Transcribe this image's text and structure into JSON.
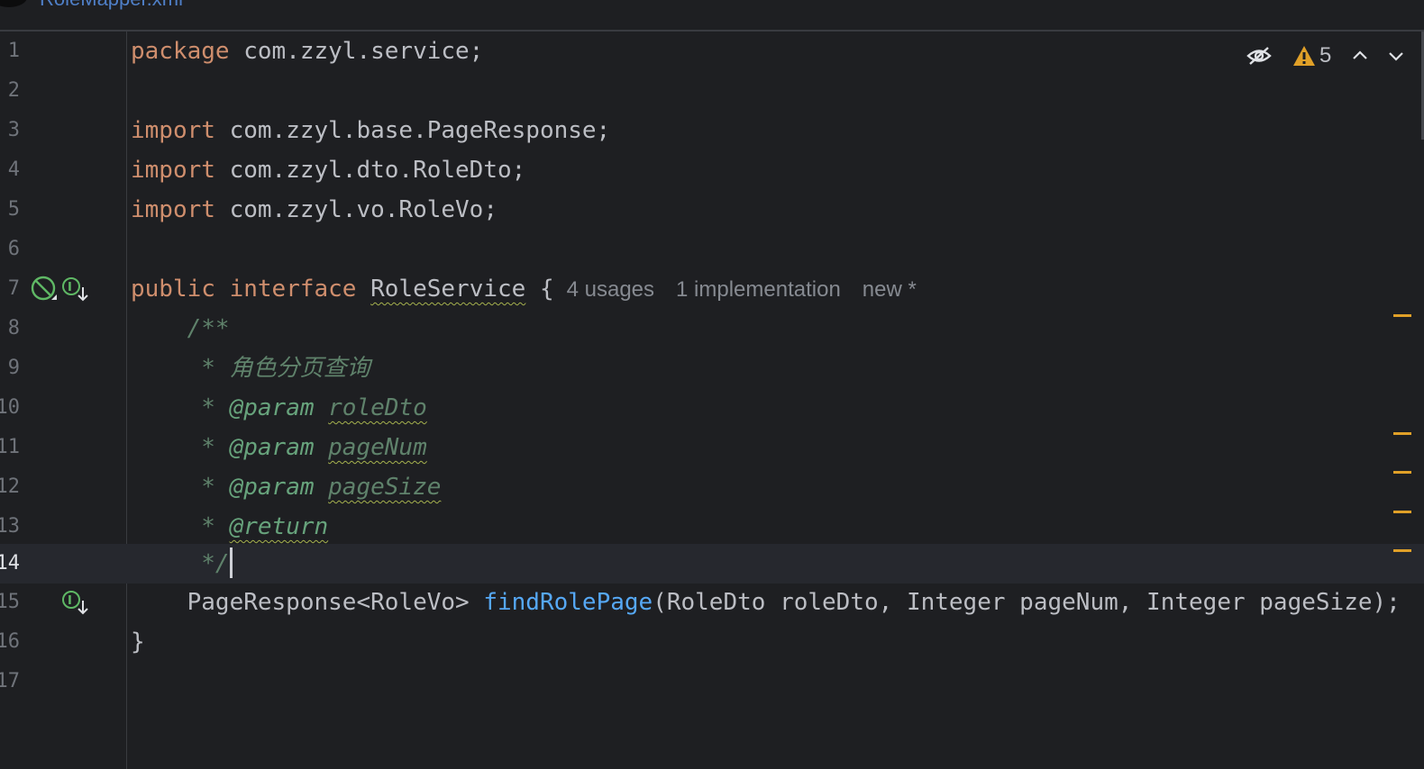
{
  "window": {
    "tab_title": "RoleMapper.xml"
  },
  "inspection": {
    "warning_count": "5"
  },
  "colors": {
    "background": "#1e1f22",
    "keyword": "#cf8e6d",
    "function": "#56a8f5",
    "doc_comment": "#5f826b",
    "warning": "#e0a028"
  },
  "editor": {
    "lines": [
      {
        "number": "1",
        "keyword": "package",
        "text": " com.zzyl.service;"
      },
      {
        "number": "2"
      },
      {
        "number": "3",
        "keyword": "import",
        "text": " com.zzyl.base.PageResponse;"
      },
      {
        "number": "4",
        "keyword": "import",
        "text": " com.zzyl.dto.RoleDto;"
      },
      {
        "number": "5",
        "keyword": "import",
        "text": " com.zzyl.vo.RoleVo;"
      },
      {
        "number": "6"
      },
      {
        "number": "7",
        "kw1": "public",
        "kw2": "interface",
        "name": "RoleService",
        "brace": " {",
        "hint_usages": "4 usages",
        "hint_impl": "1 implementation",
        "hint_new": "new *"
      },
      {
        "number": "8",
        "text": "    /**"
      },
      {
        "number": "9",
        "star": "     * ",
        "text": "角色分页查询"
      },
      {
        "number": "10",
        "star": "     * ",
        "tag": "@param",
        "param": "roleDto"
      },
      {
        "number": "11",
        "star": "     * ",
        "tag": "@param",
        "param": "pageNum"
      },
      {
        "number": "12",
        "star": "     * ",
        "tag": "@param",
        "param": "pageSize"
      },
      {
        "number": "13",
        "star": "     * ",
        "tag": "@return"
      },
      {
        "number": "14",
        "text": "     */"
      },
      {
        "number": "15",
        "pre": "    PageResponse<RoleVo> ",
        "method": "findRolePage",
        "post": "(RoleDto roleDto, Integer pageNum, Integer pageSize);"
      },
      {
        "number": "16",
        "text": "}"
      },
      {
        "number": "17"
      }
    ]
  }
}
